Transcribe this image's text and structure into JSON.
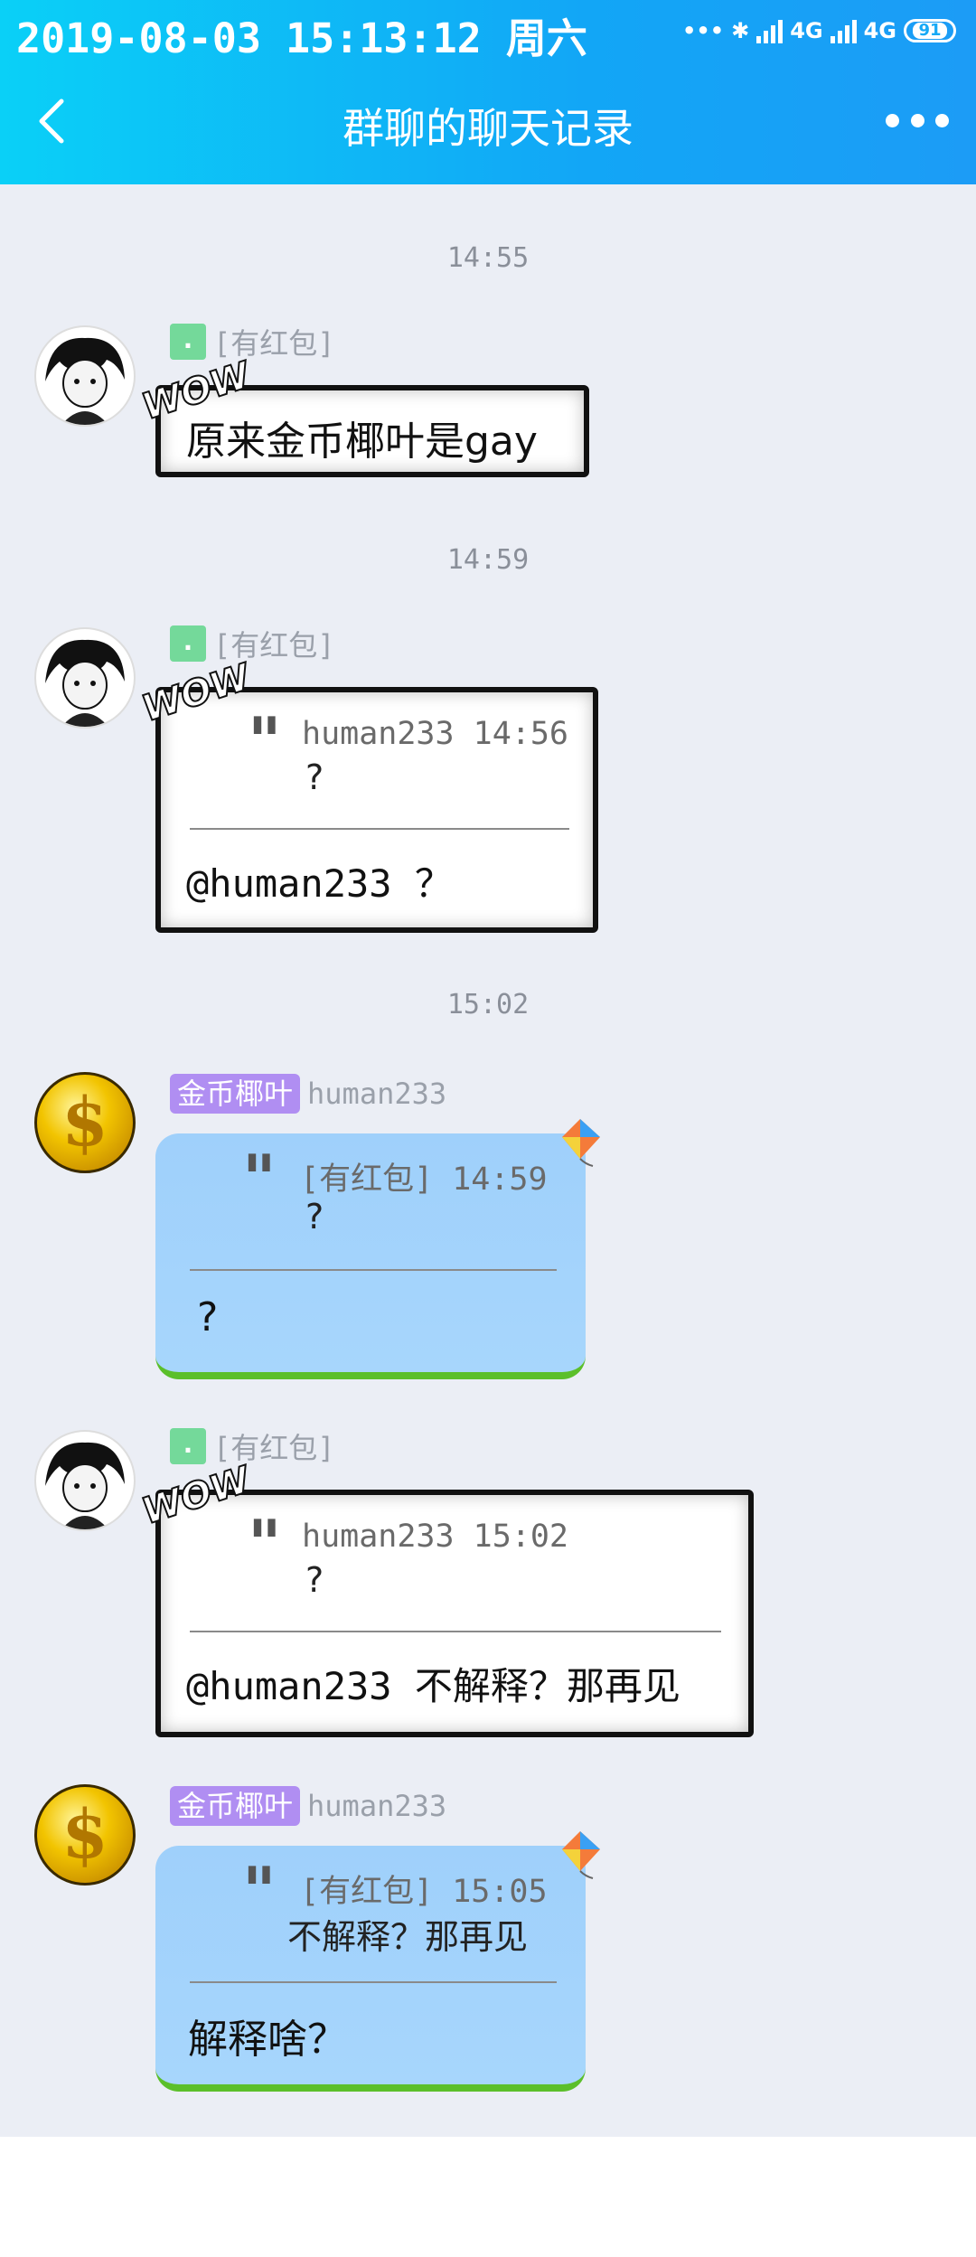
{
  "status_bar": {
    "time": "2019-08-03 15:13:12 周六",
    "network_1": "4G",
    "network_2": "4G",
    "battery": "91"
  },
  "navbar": {
    "title": "群聊的聊天记录"
  },
  "messages": [
    {
      "time": "14:55",
      "badge": ".",
      "sender": "[有红包]",
      "text": "原来金币椰叶是gay"
    },
    {
      "time": "14:59",
      "badge": ".",
      "sender": "[有红包]",
      "quote_meta": "human233 14:56",
      "quote_text": "?",
      "reply": "@human233 ？"
    },
    {
      "time": "15:02",
      "badge": "金币椰叶",
      "sender": "human233",
      "quote_meta": "[有红包] 14:59",
      "quote_text": "?",
      "reply": "?"
    },
    {
      "badge": ".",
      "sender": "[有红包]",
      "quote_meta": "human233 15:02",
      "quote_text": "?",
      "reply": "@human233 不解释？那再见"
    },
    {
      "badge": "金币椰叶",
      "sender": "human233",
      "quote_meta": "[有红包] 15:05",
      "quote_text": "不解释？那再见",
      "reply": "解释啥？"
    }
  ]
}
